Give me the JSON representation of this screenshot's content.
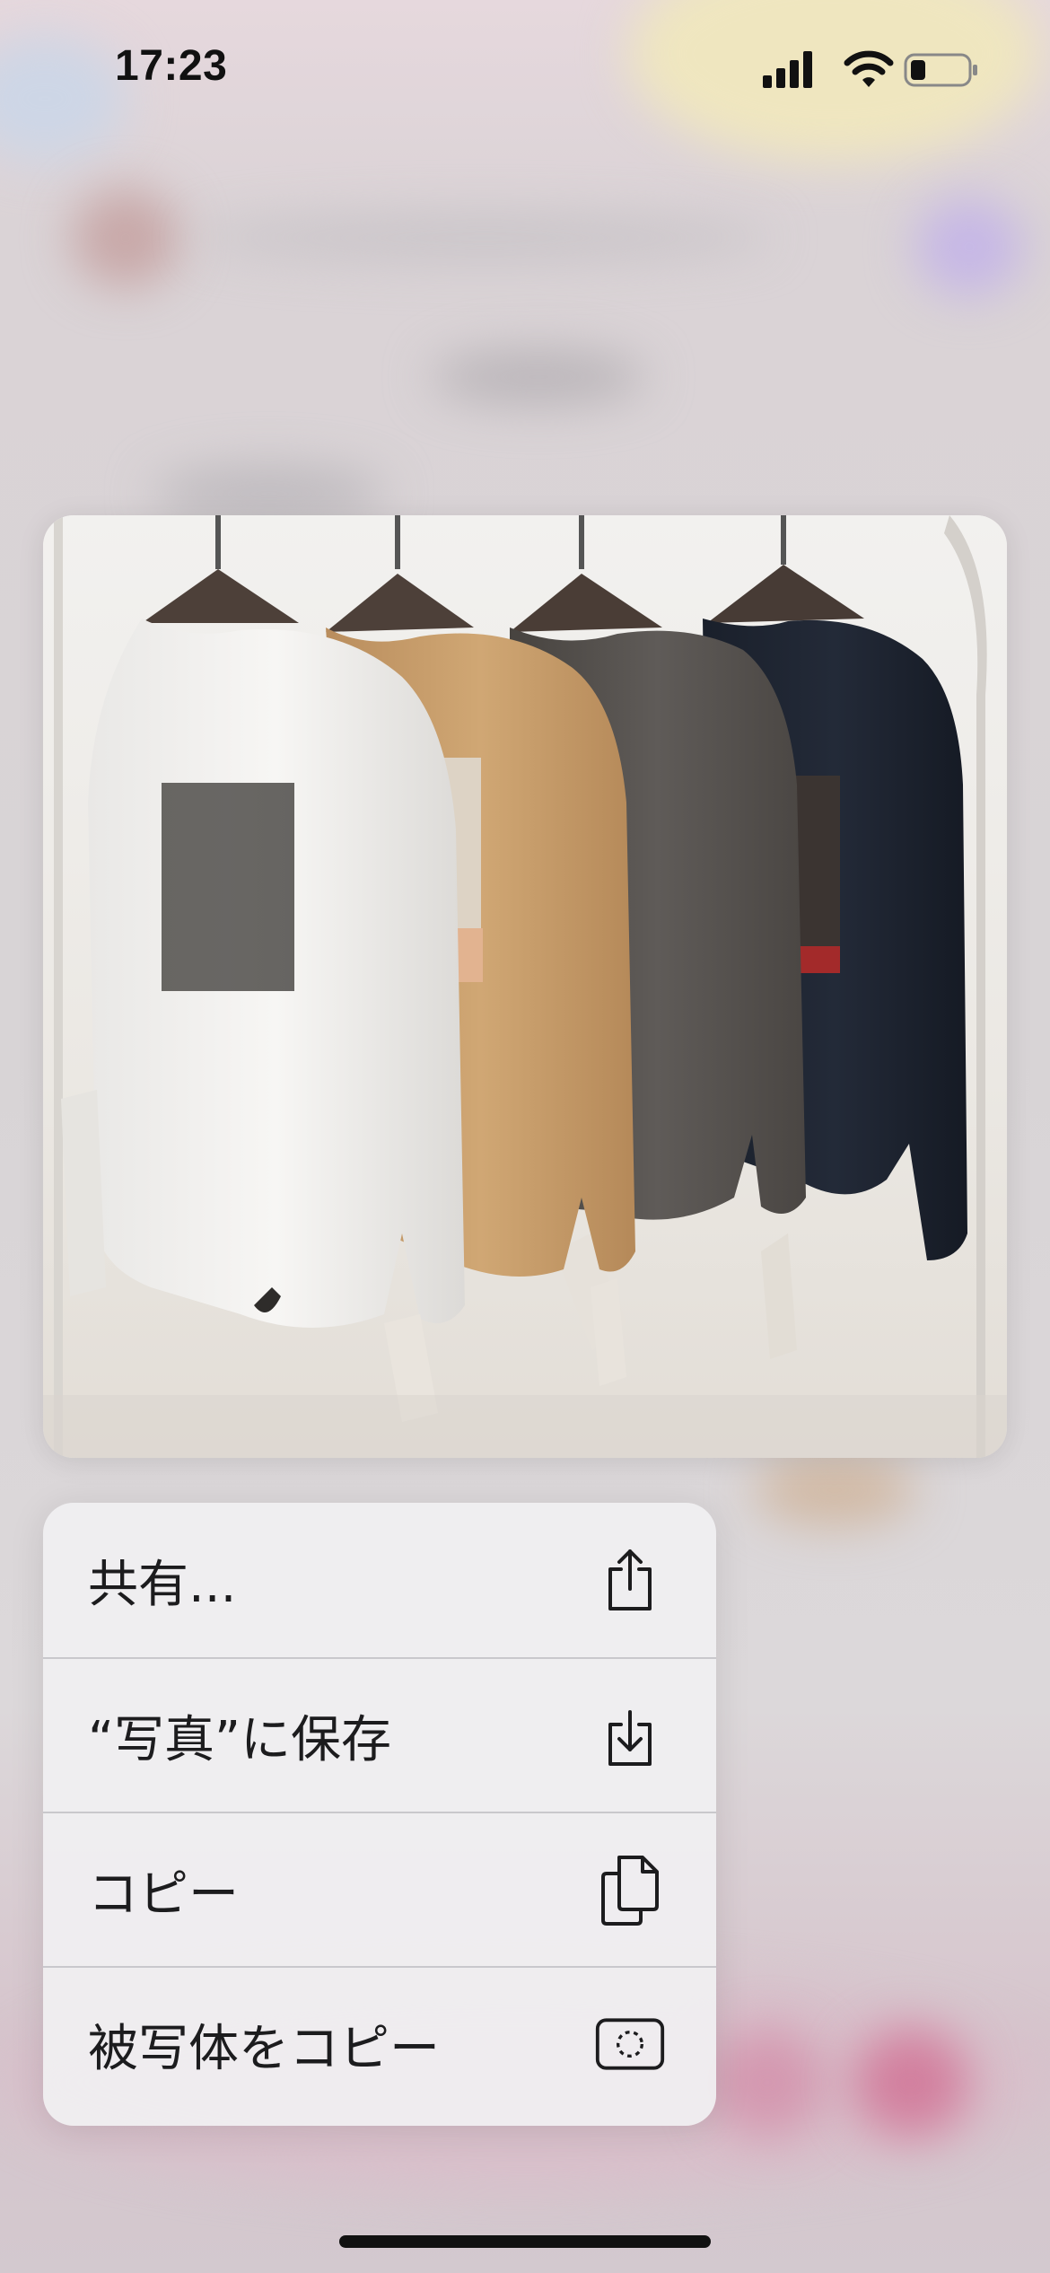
{
  "status_bar": {
    "time": "17:23",
    "signal_icon": "cellular-signal-icon",
    "wifi_icon": "wifi-icon",
    "battery_icon": "battery-low-icon"
  },
  "preview": {
    "image_icon": "product-photo-sweaters",
    "colors": [
      "#f4f3f1",
      "#c9a06f",
      "#55514f",
      "#1c2230"
    ]
  },
  "context_menu": {
    "items": [
      {
        "label": "共有...",
        "icon": "share-icon"
      },
      {
        "label": "“写真”に保存",
        "icon": "save-to-photos-icon"
      },
      {
        "label": "コピー",
        "icon": "copy-icon"
      },
      {
        "label": "被写体をコピー",
        "icon": "copy-subject-icon"
      }
    ]
  }
}
